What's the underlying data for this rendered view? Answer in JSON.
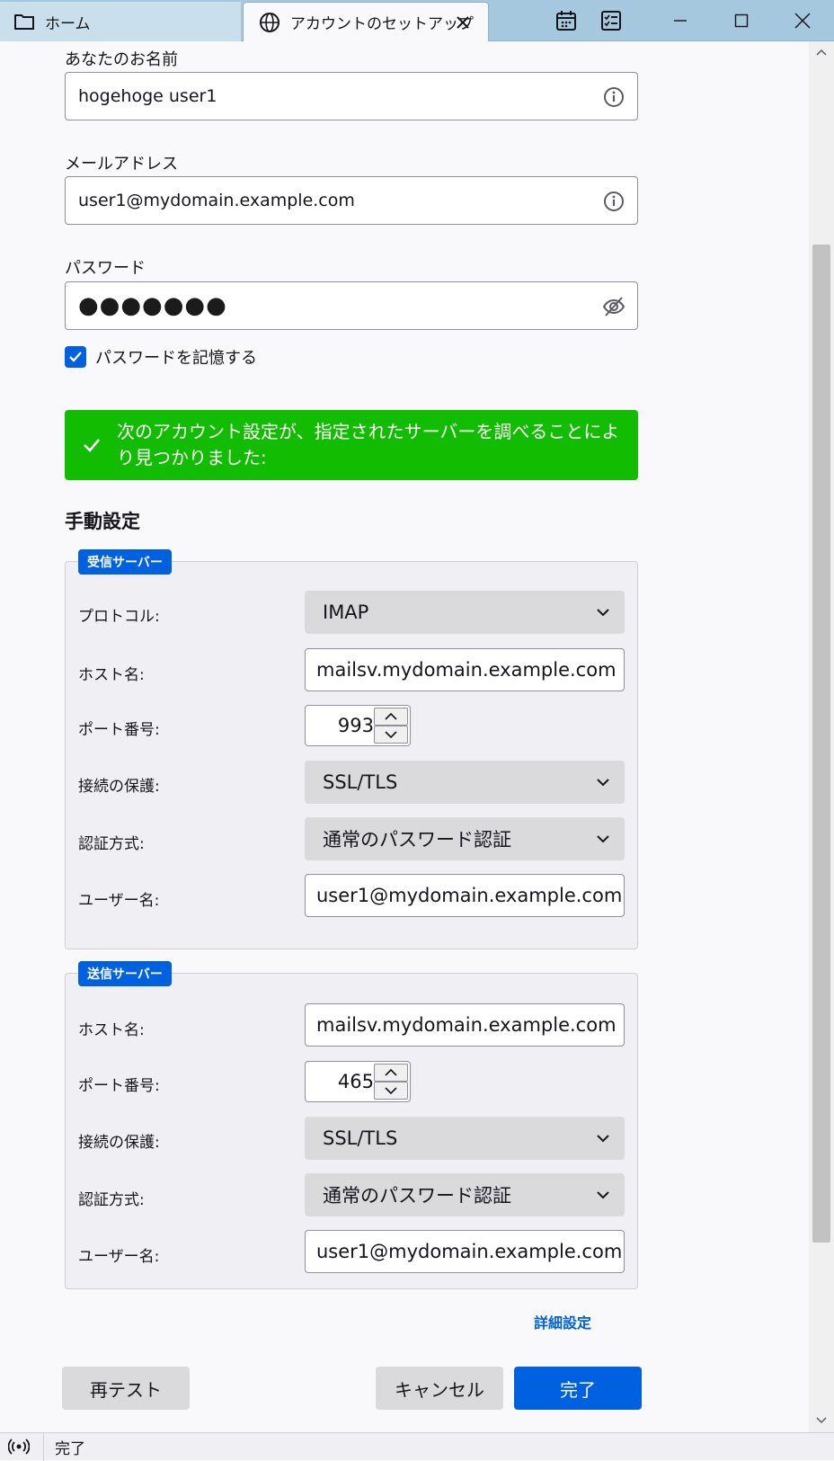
{
  "tabs": {
    "home_label": "ホーム",
    "setup_label": "アカウントのセットアップ"
  },
  "toolbar": {
    "calendar_icon": "calendar-icon",
    "tasks_icon": "tasks-icon"
  },
  "form": {
    "name_label": "あなたのお名前",
    "name_value": "hogehoge user1",
    "email_label": "メールアドレス",
    "email_value": "user1@mydomain.example.com",
    "password_label": "パスワード",
    "password_value": "●●●●●●●",
    "remember_label": "パスワードを記憶する",
    "remember_checked": true
  },
  "notice": {
    "text": "次のアカウント設定が、指定されたサーバーを調べることにより見つかりました:",
    "color": "#12bc00"
  },
  "manual": {
    "title": "手動設定"
  },
  "incoming": {
    "legend": "受信サーバー",
    "protocol_label": "プロトコル:",
    "protocol_value": "IMAP",
    "host_label": "ホスト名:",
    "host_value": "mailsv.mydomain.example.com",
    "port_label": "ポート番号:",
    "port_value": "993",
    "security_label": "接続の保護:",
    "security_value": "SSL/TLS",
    "auth_label": "認証方式:",
    "auth_value": "通常のパスワード認証",
    "user_label": "ユーザー名:",
    "user_value": "user1@mydomain.example.com"
  },
  "outgoing": {
    "legend": "送信サーバー",
    "host_label": "ホスト名:",
    "host_value": "mailsv.mydomain.example.com",
    "port_label": "ポート番号:",
    "port_value": "465",
    "security_label": "接続の保護:",
    "security_value": "SSL/TLS",
    "auth_label": "認証方式:",
    "auth_value": "通常のパスワード認証",
    "user_label": "ユーザー名:",
    "user_value": "user1@mydomain.example.com"
  },
  "advanced_link": "詳細設定",
  "buttons": {
    "retest": "再テスト",
    "cancel": "キャンセル",
    "done": "完了"
  },
  "status": {
    "text": "完了"
  },
  "colors": {
    "accent": "#0061e0",
    "titlebar": "#a6c8de"
  }
}
